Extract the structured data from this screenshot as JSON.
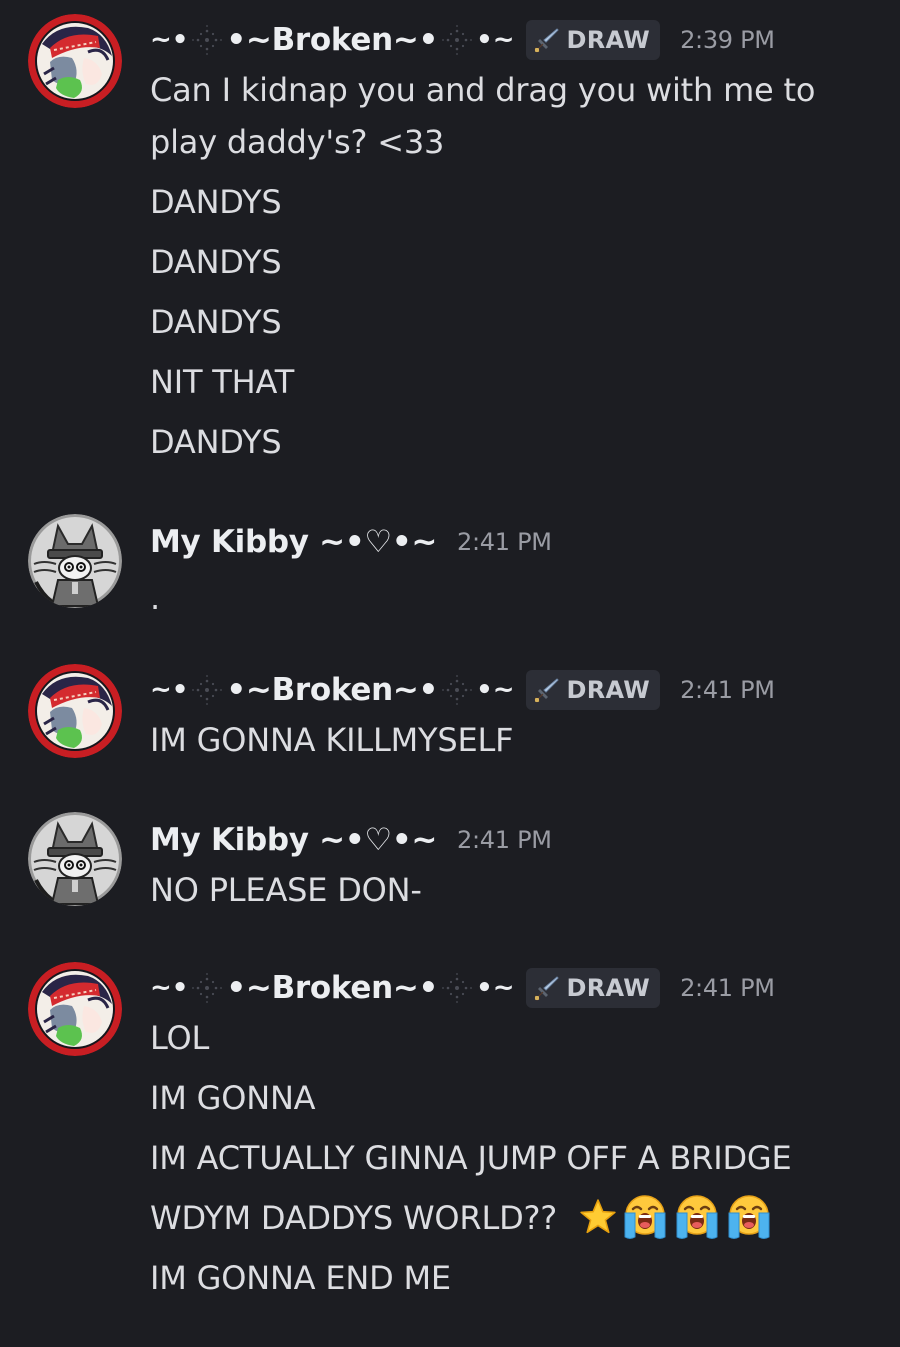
{
  "colors": {
    "background": "#1c1d22",
    "text": "#dcdde1",
    "username": "#eceef1",
    "timestamp": "#9a9ca4",
    "tag_bg": "#2c2e36"
  },
  "messages": [
    {
      "author": {
        "prefix": "~•",
        "name": "•~Broken~•",
        "suffix": "•~",
        "avatar": "broken-avatar",
        "tag": {
          "icon": "sword-icon",
          "label": "DRAW"
        }
      },
      "timestamp": "2:39 PM",
      "lines": [
        "Can I kidnap you and drag you with me to",
        "play daddy's? <33",
        "DANDYS",
        "DANDYS",
        "DANDYS",
        "NIT THAT",
        "DANDYS"
      ]
    },
    {
      "author": {
        "name": "My Kibby ~•♡•~",
        "avatar": "kibby-avatar"
      },
      "timestamp": "2:41 PM",
      "lines": [
        "."
      ]
    },
    {
      "author": {
        "prefix": "~•",
        "name": "•~Broken~•",
        "suffix": "•~",
        "avatar": "broken-avatar",
        "tag": {
          "icon": "sword-icon",
          "label": "DRAW"
        }
      },
      "timestamp": "2:41 PM",
      "lines": [
        "IM GONNA KILLMYSELF"
      ]
    },
    {
      "author": {
        "name": "My Kibby ~•♡•~",
        "avatar": "kibby-avatar"
      },
      "timestamp": "2:41 PM",
      "lines": [
        "NO PLEASE DON-"
      ]
    },
    {
      "author": {
        "prefix": "~•",
        "name": "•~Broken~•",
        "suffix": "•~",
        "avatar": "broken-avatar",
        "tag": {
          "icon": "sword-icon",
          "label": "DRAW"
        }
      },
      "timestamp": "2:41 PM",
      "lines": [
        "LOL",
        "IM GONNA",
        "IM ACTUALLY GINNA JUMP OFF A BRIDGE",
        "WDYM DADDYS WORLD??",
        "IM GONNA END ME"
      ],
      "line_emojis": [
        "star-emoji",
        "loudly-crying-emoji",
        "loudly-crying-emoji",
        "loudly-crying-emoji"
      ]
    }
  ]
}
